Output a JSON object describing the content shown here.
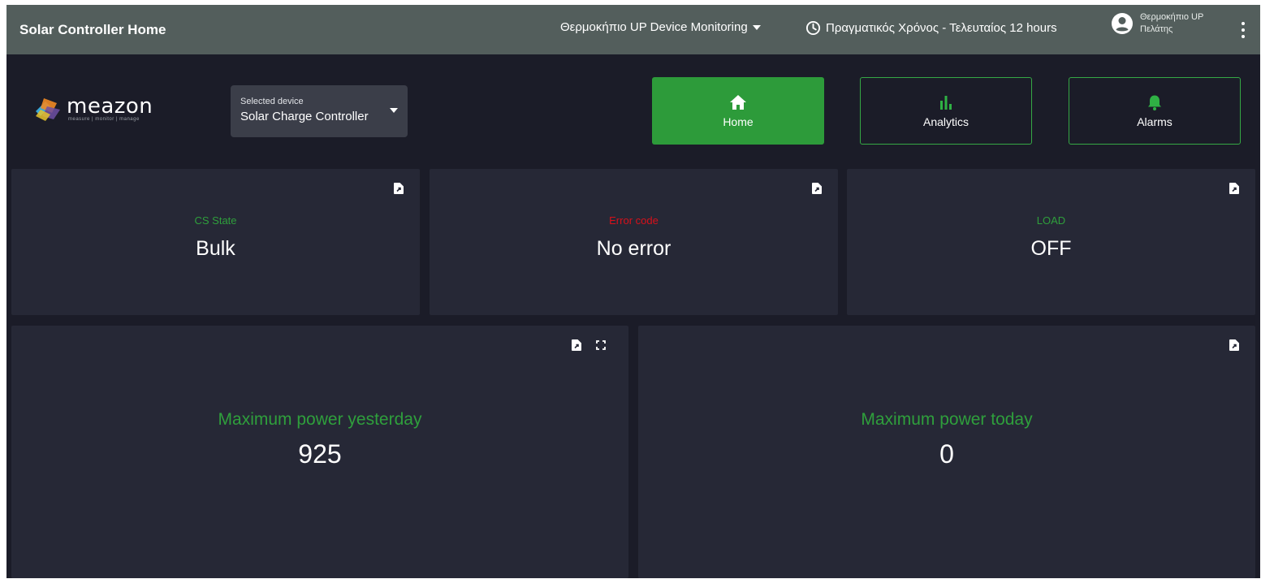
{
  "topbar": {
    "title": "Solar Controller Home",
    "dashboard_selector": "Θερμοκήπιο UP Device Monitoring",
    "time_window": "Πραγματικός Χρόνος - Τελευταίος 12 hours",
    "user_name": "Θερμοκήπιο UP",
    "user_role": "Πελάτης"
  },
  "logo": {
    "word": "meazon",
    "tagline": "measure | monitor | manage"
  },
  "device": {
    "label": "Selected device",
    "value": "Solar Charge Controller"
  },
  "nav": {
    "home": "Home",
    "analytics": "Analytics",
    "alarms": "Alarms"
  },
  "cards": {
    "cs_state": {
      "label": "CS State",
      "value": "Bulk"
    },
    "error_code": {
      "label": "Error code",
      "value": "No error"
    },
    "load": {
      "label": "LOAD",
      "value": "OFF"
    },
    "max_yesterday": {
      "label": "Maximum power yesterday",
      "value": "925"
    },
    "max_today": {
      "label": "Maximum power today",
      "value": "0"
    }
  },
  "colors": {
    "green_label": "#2f9f3c",
    "red_label": "#d9101a",
    "accent_green": "#2d9b3a"
  },
  "icons": {
    "export": "file-export-icon",
    "fullscreen": "fullscreen-icon"
  }
}
